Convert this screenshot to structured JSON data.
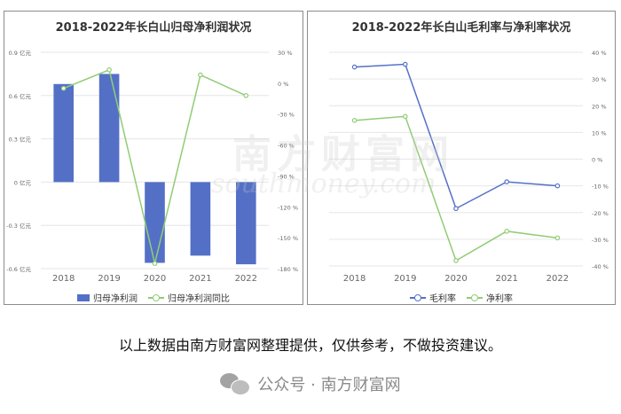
{
  "chart_data": [
    {
      "type": "bar",
      "title": "2018-2022年长白山归母净利润状况",
      "categories": [
        "2018",
        "2019",
        "2020",
        "2021",
        "2022"
      ],
      "series": [
        {
          "name": "归母净利润",
          "type": "bar",
          "axis": "left",
          "color": "#5470c6",
          "values": [
            0.68,
            0.75,
            -0.56,
            -0.51,
            -0.57
          ]
        },
        {
          "name": "归母净利润同比",
          "type": "line",
          "axis": "right",
          "color": "#91cc75",
          "values": [
            -5,
            13,
            -175,
            8,
            -12
          ]
        }
      ],
      "yleft": {
        "ticks": [
          0.9,
          0.6,
          0.3,
          0,
          -0.3,
          -0.6
        ],
        "tick_labels": [
          "0.9 亿元",
          "0.6 亿元",
          "0.3 亿元",
          "0 亿元",
          "-0.3 亿元",
          "-0.6 亿元"
        ],
        "ylim": [
          -0.6,
          0.9
        ]
      },
      "yright": {
        "ticks": [
          30,
          0,
          -30,
          -60,
          -90,
          -120,
          -150,
          -180
        ],
        "tick_labels": [
          "30 %",
          "0 %",
          "-30 %",
          "-60 %",
          "-90 %",
          "-120 %",
          "-150 %",
          "-180 %"
        ],
        "ylim": [
          -180,
          30
        ]
      },
      "legend": "bottom",
      "grid": true
    },
    {
      "type": "line",
      "title": "2018-2022年长白山毛利率与净利率状况",
      "categories": [
        "2018",
        "2019",
        "2020",
        "2021",
        "2022"
      ],
      "series": [
        {
          "name": "毛利率",
          "color": "#5470c6",
          "values": [
            34.5,
            35.5,
            -18.5,
            -8.5,
            -10
          ]
        },
        {
          "name": "净利率",
          "color": "#91cc75",
          "values": [
            14.5,
            16,
            -38,
            -27,
            -29.5
          ]
        }
      ],
      "yright": {
        "ticks": [
          40,
          30,
          20,
          10,
          0,
          -10,
          -20,
          -30,
          -40
        ],
        "tick_labels": [
          "40 %",
          "30 %",
          "20 %",
          "10 %",
          "0 %",
          "-10 %",
          "-20 %",
          "-30 %",
          "-40 %"
        ],
        "ylim": [
          -40,
          40
        ]
      },
      "legend": "bottom",
      "grid": true
    }
  ],
  "watermark": {
    "text": "南方财富网",
    "sub": "southmoney.com"
  },
  "footnote": "以上数据由南方财富网整理提供，仅供参考，不做投资建议。",
  "brand": {
    "text": "公众号 · 南方财富网",
    "icon": "wechat-icon"
  }
}
